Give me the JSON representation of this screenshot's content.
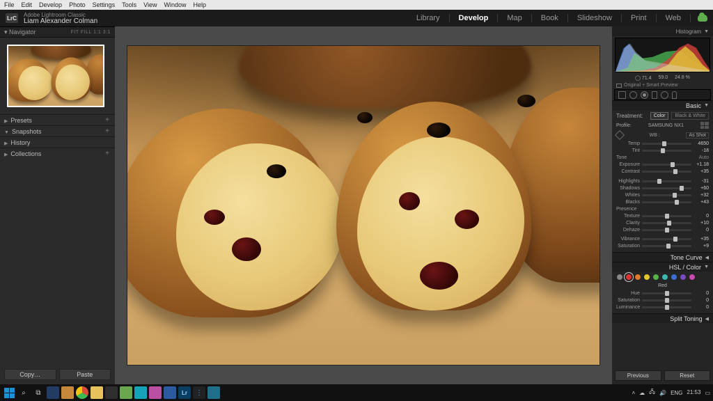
{
  "menu": {
    "items": [
      "File",
      "Edit",
      "Develop",
      "Photo",
      "Settings",
      "Tools",
      "View",
      "Window",
      "Help"
    ]
  },
  "app": {
    "product": "Adobe Lightroom Classic",
    "user": "Liam Alexander Colman",
    "modules": [
      "Library",
      "Develop",
      "Map",
      "Book",
      "Slideshow",
      "Print",
      "Web"
    ],
    "active_module": "Develop"
  },
  "left": {
    "navigator": {
      "title": "Navigator",
      "modes": "FIT  FILL  1:1  3:1"
    },
    "sections": [
      {
        "label": "Presets",
        "plus": "+"
      },
      {
        "label": "Snapshots",
        "plus": "+"
      },
      {
        "label": "History",
        "plus": ""
      },
      {
        "label": "Collections",
        "plus": "+"
      }
    ],
    "copy_btn": "Copy…",
    "paste_btn": "Paste"
  },
  "right": {
    "histogram_title": "Histogram",
    "readout": {
      "a": "71.4",
      "b": "59.0",
      "c": "24.8 %"
    },
    "smart_preview": "Original + Smart Preview",
    "basic": {
      "title": "Basic",
      "treatment_label": "Treatment:",
      "treat_color": "Color",
      "treat_bw": "Black & White",
      "profile_label": "Profile:",
      "profile_value": "SAMSUNG NX1",
      "wb_label": "WB :",
      "wb_value": "As Shot",
      "rows": {
        "temp": {
          "lbl": "Temp",
          "val": "4650",
          "pos": 45
        },
        "tint": {
          "lbl": "Tint",
          "val": "-18",
          "pos": 42
        },
        "tone_hd": "Tone",
        "tone_auto": "Auto",
        "exposure": {
          "lbl": "Exposure",
          "val": "+1.18",
          "pos": 62
        },
        "contrast": {
          "lbl": "Contrast",
          "val": "+35",
          "pos": 67
        },
        "highlights": {
          "lbl": "Highlights",
          "val": "-31",
          "pos": 35
        },
        "shadows": {
          "lbl": "Shadows",
          "val": "+60",
          "pos": 80
        },
        "whites": {
          "lbl": "Whites",
          "val": "+32",
          "pos": 66
        },
        "blacks": {
          "lbl": "Blacks",
          "val": "+43",
          "pos": 71
        },
        "presence_hd": "Presence",
        "texture": {
          "lbl": "Texture",
          "val": "0",
          "pos": 50
        },
        "clarity": {
          "lbl": "Clarity",
          "val": "+10",
          "pos": 55
        },
        "dehaze": {
          "lbl": "Dehaze",
          "val": "0",
          "pos": 50
        },
        "vibrance": {
          "lbl": "Vibrance",
          "val": "+35",
          "pos": 67
        },
        "saturation": {
          "lbl": "Saturation",
          "val": "+9",
          "pos": 54
        }
      }
    },
    "tone_curve": "Tone Curve",
    "hsl": {
      "title": "HSL / Color",
      "selected": "Red",
      "colors": [
        "#d33",
        "#e07b2a",
        "#e4c72c",
        "#58b24a",
        "#3bb7b0",
        "#3a6fd1",
        "#7a4ac3",
        "#c94bb1"
      ],
      "rows": {
        "hue": {
          "lbl": "Hue",
          "val": "0",
          "pos": 50
        },
        "sat": {
          "lbl": "Saturation",
          "val": "0",
          "pos": 50
        },
        "lum": {
          "lbl": "Luminance",
          "val": "0",
          "pos": 50
        }
      }
    },
    "split": "Split Toning",
    "prev_btn": "Previous",
    "reset_btn": "Reset"
  },
  "taskbar": {
    "lang": "ENG",
    "time": "21:53"
  }
}
